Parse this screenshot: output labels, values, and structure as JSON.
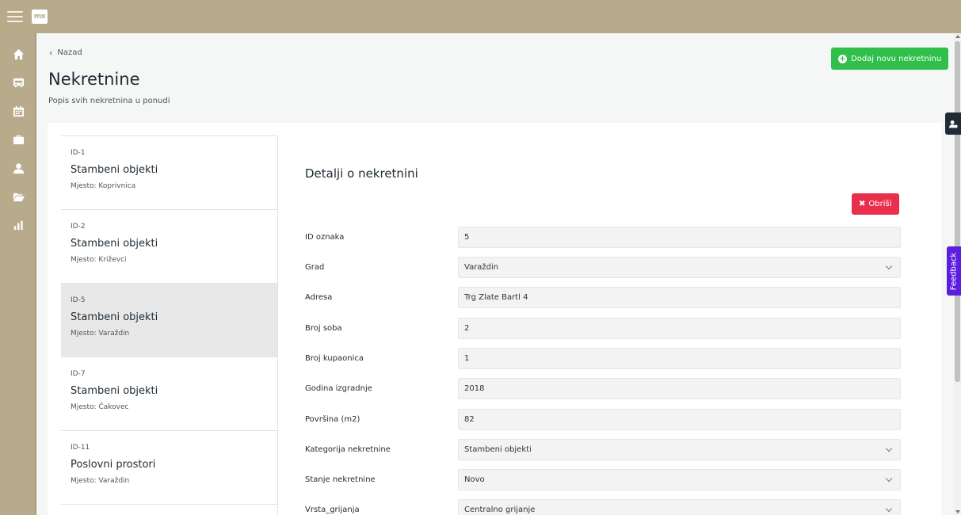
{
  "app": {
    "logo_text": "mx"
  },
  "sidebar": {
    "icons": [
      "home-icon",
      "bus-icon",
      "calendar-icon",
      "briefcase-icon",
      "user-icon",
      "folder-open-icon",
      "bar-chart-icon"
    ]
  },
  "header": {
    "back_label": "Nazad",
    "title": "Nekretnine",
    "subtitle": "Popis svih nekretnina u ponudi",
    "add_button": "Dodaj novu nekretninu"
  },
  "list": {
    "items": [
      {
        "id": "ID-1",
        "title": "Stambeni objekti",
        "place": "Mjesto: Koprivnica",
        "selected": false
      },
      {
        "id": "ID-2",
        "title": "Stambeni objekti",
        "place": "Mjesto: Križevci",
        "selected": false
      },
      {
        "id": "ID-5",
        "title": "Stambeni objekti",
        "place": "Mjesto: Varaždin",
        "selected": true
      },
      {
        "id": "ID-7",
        "title": "Stambeni objekti",
        "place": "Mjesto: Čakovec",
        "selected": false
      },
      {
        "id": "ID-11",
        "title": "Poslovni prostori",
        "place": "Mjesto: Varaždin",
        "selected": false
      }
    ]
  },
  "detail": {
    "title": "Detalji o nekretnini",
    "delete_button": "Obriši",
    "fields": [
      {
        "label": "ID oznaka",
        "value": "5",
        "type": "text"
      },
      {
        "label": "Grad",
        "value": "Varaždin",
        "type": "select"
      },
      {
        "label": "Adresa",
        "value": "Trg Zlate Bartl 4",
        "type": "text"
      },
      {
        "label": "Broj soba",
        "value": "2",
        "type": "text"
      },
      {
        "label": "Broj kupaonica",
        "value": "1",
        "type": "text"
      },
      {
        "label": "Godina izgradnje",
        "value": "2018",
        "type": "text"
      },
      {
        "label": "Površina (m2)",
        "value": "82",
        "type": "text"
      },
      {
        "label": "Kategorija nekretnine",
        "value": "Stambeni objekti",
        "type": "select"
      },
      {
        "label": "Stanje nekretnine",
        "value": "Novo",
        "type": "select"
      },
      {
        "label": "Vrsta_grijanja",
        "value": "Centralno grijanje",
        "type": "select"
      }
    ]
  },
  "feedback": {
    "label": "Feedback"
  },
  "colors": {
    "topbar": "#b7ab8b",
    "add_button": "#2fbf4a",
    "delete_button": "#e8304e",
    "feedback_tab": "#5a1ee0",
    "selected_row": "#e8e8e8"
  }
}
